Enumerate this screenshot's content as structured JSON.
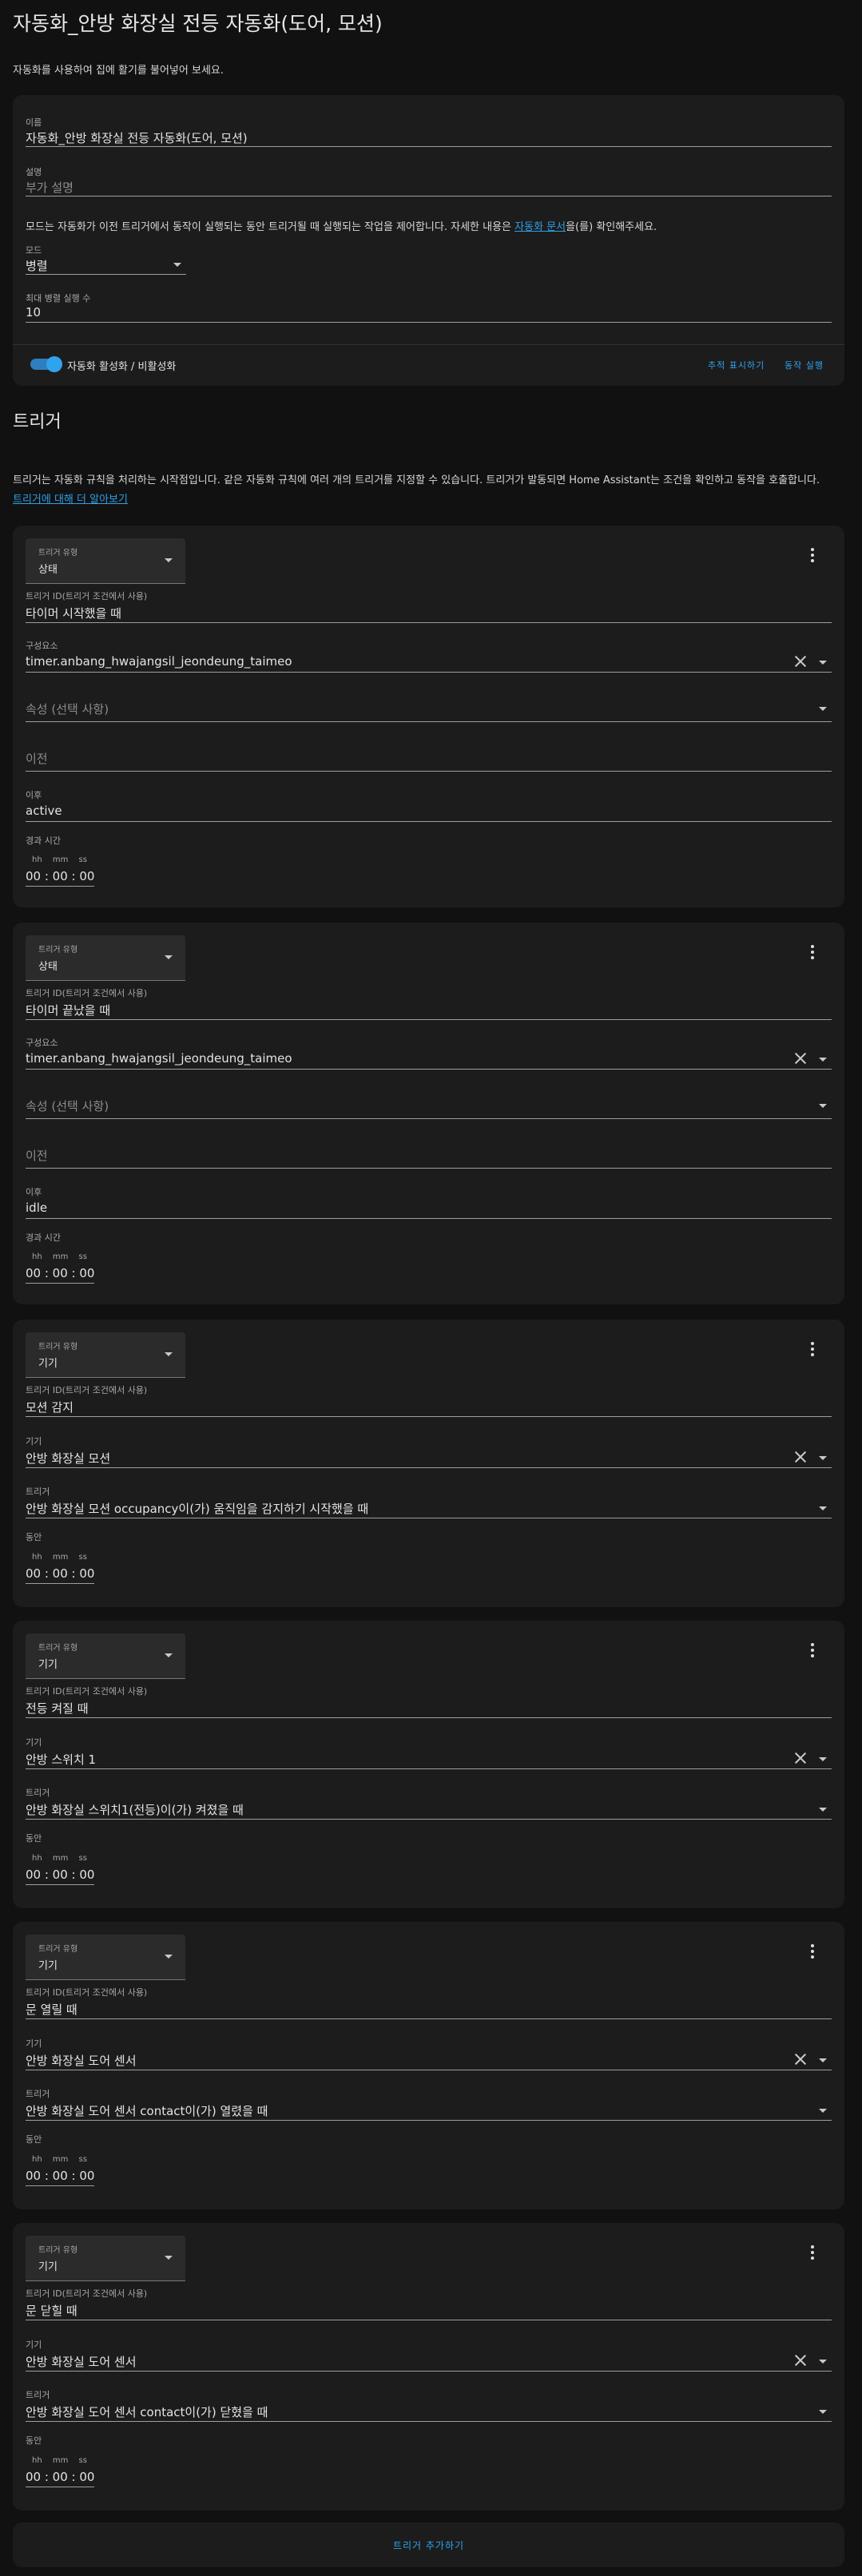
{
  "page": {
    "title": "자동화_안방 화장실 전등 자동화(도어, 모션)",
    "description": "자동화를 사용하여 집에 활기를 불어넣어 보세요."
  },
  "settings": {
    "name_label": "이름",
    "name_value": "자동화_안방 화장실 전등 자동화(도어, 모션)",
    "description_label": "설명",
    "description_placeholder": "부가 설명",
    "info_before": "모드는 자동화가 이전 트리거에서 동작이 실행되는 동안 트리거될 때 실행되는 작업을 제어합니다. 자세한 내용은 ",
    "info_link": "자동화 문서",
    "info_after": "을(를) 확인해주세요.",
    "mode_label": "모드",
    "mode_value": "병렬",
    "max_label": "최대 병렬 실행 수",
    "max_value": "10",
    "toggle_label": "자동화 활성화 / 비활성화",
    "show_trace": "추적 표시하기",
    "run_action": "동작 실행"
  },
  "triggers_section": {
    "heading": "트리거",
    "description": "트리거는 자동화 규칙을 처리하는 시작점입니다. 같은 자동화 규칙에 여러 개의 트리거를 지정할 수 있습니다. 트리거가 발동되면 Home Assistant는 조건을 확인하고 동작을 호출합니다.",
    "learn_more": "트리거에 대해 더 알아보기",
    "add_button": "트리거 추가하기"
  },
  "common": {
    "trigger_type_label": "트리거 유형",
    "trigger_id_label": "트리거 ID(트리거 조건에서 사용)",
    "entity_label": "구성요소",
    "attribute_placeholder": "속성 (선택 사항)",
    "from_placeholder": "이전",
    "to_label": "이후",
    "duration_label": "경과 시간",
    "device_label": "기기",
    "trigger_label": "트리거",
    "for_label": "동안",
    "hh": "hh",
    "mm": "mm",
    "ss": "ss",
    "duration_value": "00 : 00 : 00"
  },
  "triggers": [
    {
      "type": "상태",
      "id": "타이머 시작했을 때",
      "entity": "timer.anbang_hwajangsil_jeondeung_taimeo",
      "to": "active"
    },
    {
      "type": "상태",
      "id": "타이머 끝났을 때",
      "entity": "timer.anbang_hwajangsil_jeondeung_taimeo",
      "to": "idle"
    },
    {
      "type": "기기",
      "id": "모션 감지",
      "device": "안방 화장실 모션",
      "trigger": "안방 화장실 모션 occupancy이(가) 움직임을 감지하기 시작했을 때"
    },
    {
      "type": "기기",
      "id": "전등 켜질 때",
      "device": "안방 스위치 1",
      "trigger": "안방 화장실 스위치1(전등)이(가) 켜졌을 때"
    },
    {
      "type": "기기",
      "id": "문 열릴 때",
      "device": "안방 화장실 도어 센서",
      "trigger": "안방 화장실 도어 센서 contact이(가) 열렸을 때"
    },
    {
      "type": "기기",
      "id": "문 닫힐 때",
      "device": "안방 화장실 도어 센서",
      "trigger": "안방 화장실 도어 센서 contact이(가) 닫혔을 때"
    }
  ],
  "colors": {
    "accent": "#2fa4ee",
    "card": "#1c1c1c",
    "background": "#111111"
  }
}
